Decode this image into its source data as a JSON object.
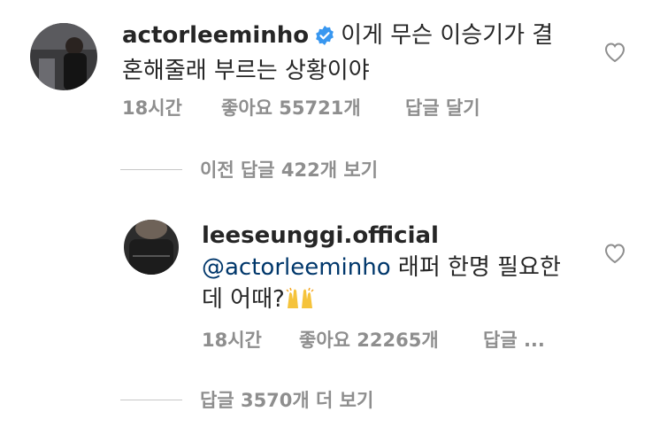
{
  "comments": [
    {
      "username": "actorleeminho",
      "verified": true,
      "text": "이게 무슨 이승기가 결혼해줄래 부르는 상황이야",
      "time": "18시간",
      "likes": "좋아요 55721개",
      "reply_label": "답글 달기",
      "icon_avatar": "profile-photo",
      "icon_like": "heart-outline-icon"
    },
    {
      "username": "leeseunggi.official",
      "mention": "@actorleeminho",
      "text": "래퍼 한명 필요한데 어때?",
      "emoji": "raising-hands-icon",
      "time": "18시간",
      "likes": "좋아요 22265개",
      "reply_label": "답글 ...",
      "icon_avatar": "profile-photo",
      "icon_like": "heart-outline-icon"
    }
  ],
  "view_previous_replies": "이전 답글 422개 보기",
  "view_more_replies": "답글 3570개 더 보기",
  "colors": {
    "text": "#262626",
    "meta": "#8e8e8e",
    "mention": "#00376b",
    "verified": "#3897f0"
  }
}
